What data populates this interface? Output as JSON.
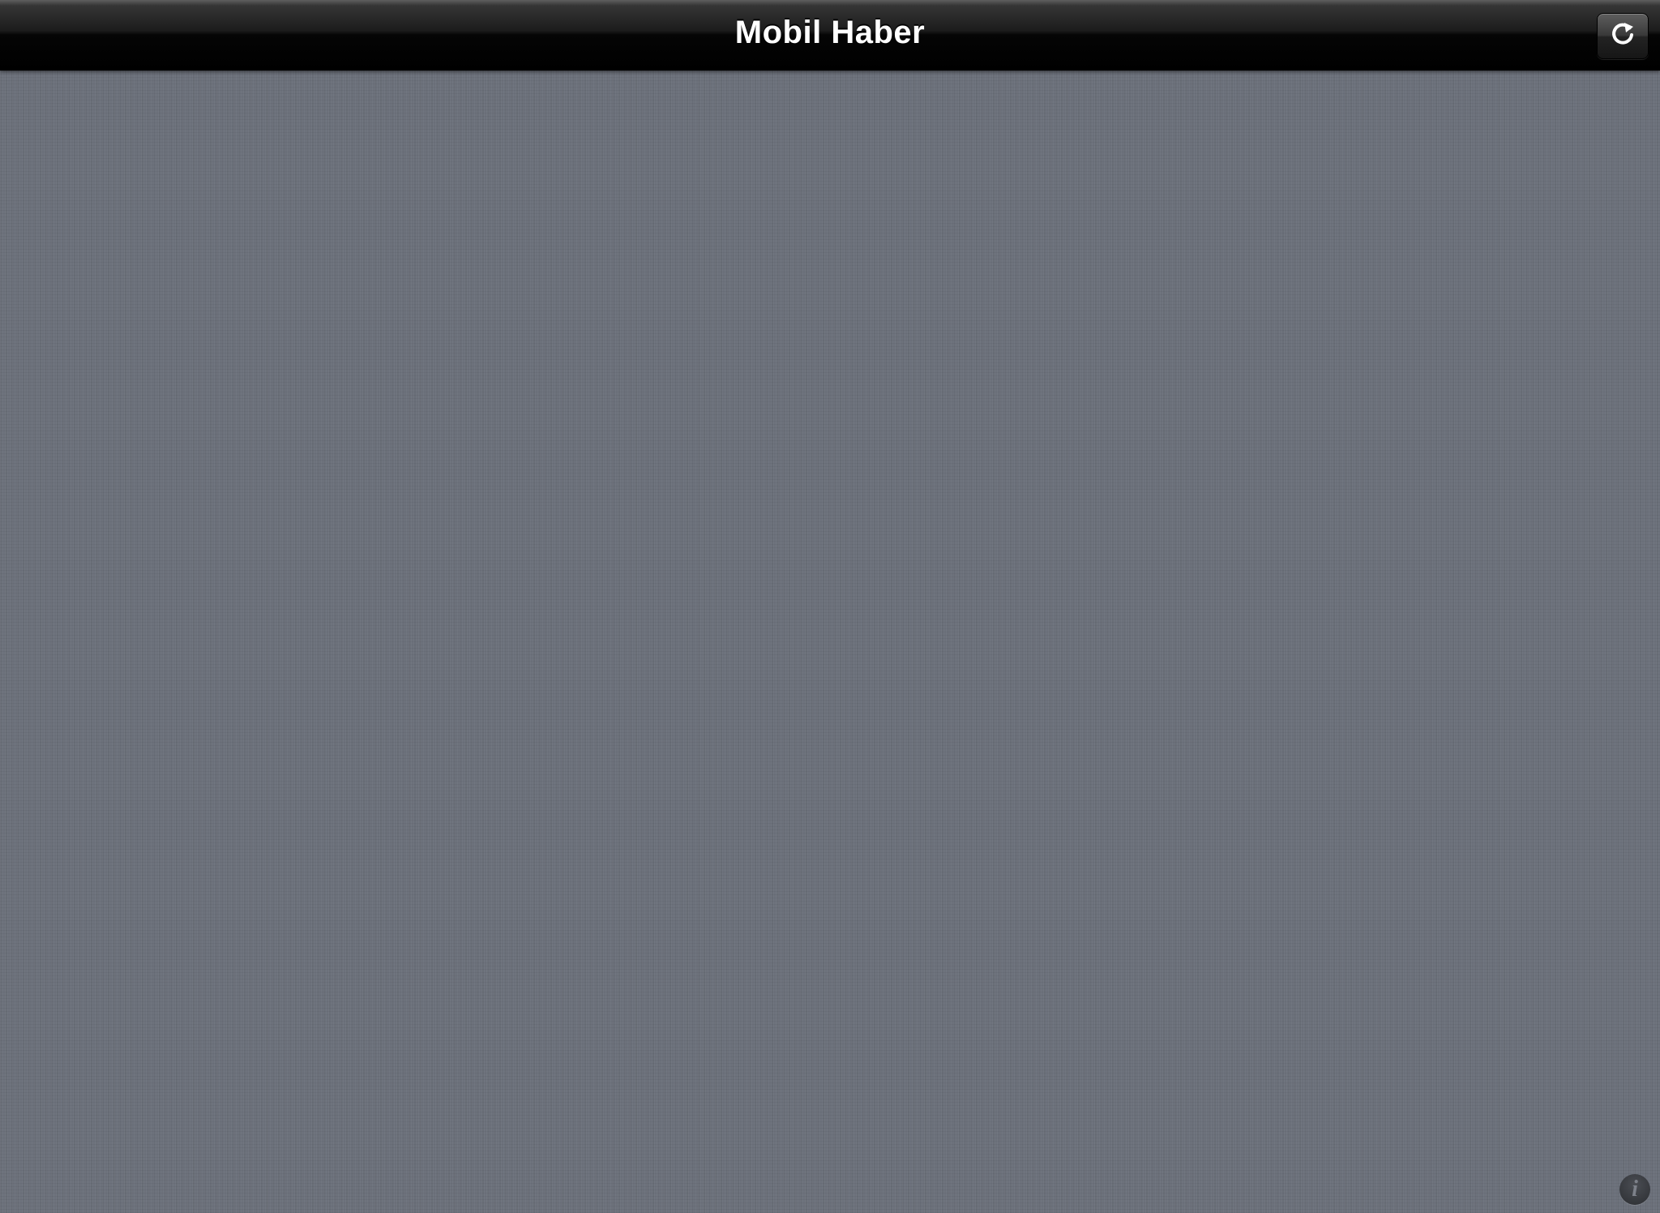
{
  "navbar": {
    "title": "Mobil Haber",
    "refresh_icon": "refresh-icon"
  },
  "footer": {
    "info_icon_glyph": "i",
    "info_icon": "info-icon"
  },
  "colors": {
    "background": "#6c717b",
    "navbar": "#000000",
    "title_text": "#ffffff"
  }
}
